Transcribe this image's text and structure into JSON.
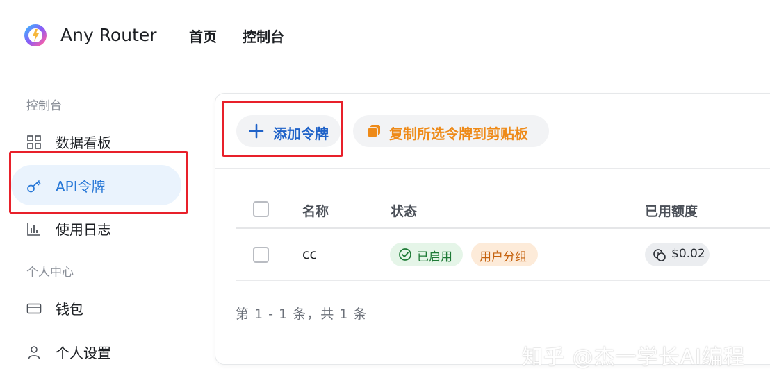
{
  "header": {
    "brand": "Any Router",
    "nav": [
      "首页",
      "控制台"
    ]
  },
  "sidebar": {
    "section_console": "控制台",
    "items": [
      {
        "label": "数据看板",
        "icon": "dashboard-icon"
      },
      {
        "label": "API令牌",
        "icon": "key-icon",
        "active": true
      },
      {
        "label": "使用日志",
        "icon": "bar-chart-icon"
      }
    ],
    "section_personal": "个人中心",
    "personal_items": [
      {
        "label": "钱包",
        "icon": "wallet-icon"
      },
      {
        "label": "个人设置",
        "icon": "user-icon"
      }
    ]
  },
  "toolbar": {
    "add_label": "添加令牌",
    "copy_label": "复制所选令牌到剪贴板"
  },
  "table": {
    "columns": [
      "名称",
      "状态",
      "已用额度"
    ],
    "rows": [
      {
        "name": "cc",
        "status": "已启用",
        "group": "用户分组",
        "used_quota": "$0.02"
      }
    ]
  },
  "pagination": "第 1 - 1 条，共 1 条",
  "watermark": "知乎 @杰一学长AI编程",
  "colors": {
    "accent": "#2878d7",
    "highlight": "#e8202a",
    "copy": "#ee8a18",
    "status_ok": "#1e7a36"
  }
}
